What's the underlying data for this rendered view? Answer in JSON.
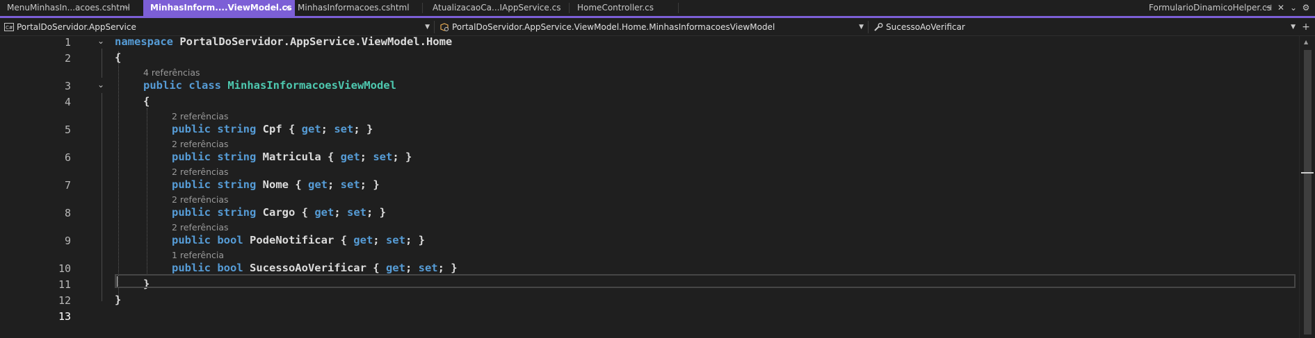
{
  "tabs": [
    {
      "label": "MenuMinhasIn...acoes.cshtml",
      "pin": "⊣"
    },
    {
      "label": "MinhasInform....ViewModel.cs",
      "pin": "⊣",
      "close": "✕"
    },
    {
      "label": "MinhasInformacoes.cshtml"
    },
    {
      "label": "AtualizacaoCa...IAppService.cs"
    },
    {
      "label": "HomeController.cs"
    },
    {
      "label": "FormularioDinamicoHelper.cs"
    }
  ],
  "tab_icons": {
    "pin": "⊣",
    "close": "✕",
    "overflow": "⌄",
    "settings": "⚙"
  },
  "navbar": {
    "project": "PortalDoServidor.AppService",
    "type": "PortalDoServidor.AppService.ViewModel.Home.MinhasInformacoesViewModel",
    "member": "SucessoAoVerificar",
    "dropdown_arrow": "▼",
    "add_icon": "+"
  },
  "code": {
    "line_numbers": [
      "1",
      "2",
      "3",
      "4",
      "5",
      "6",
      "7",
      "8",
      "9",
      "10",
      "11",
      "12",
      "13"
    ],
    "fold_glyph": "⌄",
    "line1": {
      "kw": "namespace",
      "rest": " PortalDoServidor.AppService.ViewModel.Home"
    },
    "line2": "{",
    "lens3": "4 referências",
    "line3": {
      "kw": "public class",
      "type": "MinhasInformacoesViewModel"
    },
    "line4": "{",
    "props": [
      {
        "lens": "2 referências",
        "kw": "public string",
        "name": " Cpf { ",
        "get": "get",
        "semi1": "; ",
        "set": "set",
        "end": "; }"
      },
      {
        "lens": "2 referências",
        "kw": "public string",
        "name": " Matricula { ",
        "get": "get",
        "semi1": "; ",
        "set": "set",
        "end": "; }"
      },
      {
        "lens": "2 referências",
        "kw": "public string",
        "name": " Nome { ",
        "get": "get",
        "semi1": "; ",
        "set": "set",
        "end": "; }"
      },
      {
        "lens": "2 referências",
        "kw": "public string",
        "name": " Cargo { ",
        "get": "get",
        "semi1": "; ",
        "set": "set",
        "end": "; }"
      },
      {
        "lens": "2 referências",
        "kw": "public bool",
        "name": " PodeNotificar { ",
        "get": "get",
        "semi1": "; ",
        "set": "set",
        "end": "; }"
      },
      {
        "lens": "1 referência",
        "kw": "public bool",
        "name": " SucessoAoVerificar { ",
        "get": "get",
        "semi1": "; ",
        "set": "set",
        "end": "; }"
      }
    ],
    "line11": "}",
    "line12": "}"
  },
  "scrollbar": {
    "up": "▲",
    "down": "▼"
  },
  "colors": {
    "accent": "#7c5fd6",
    "keyword": "#569cd6",
    "type": "#4ec9b0",
    "background": "#1f1f1f"
  }
}
